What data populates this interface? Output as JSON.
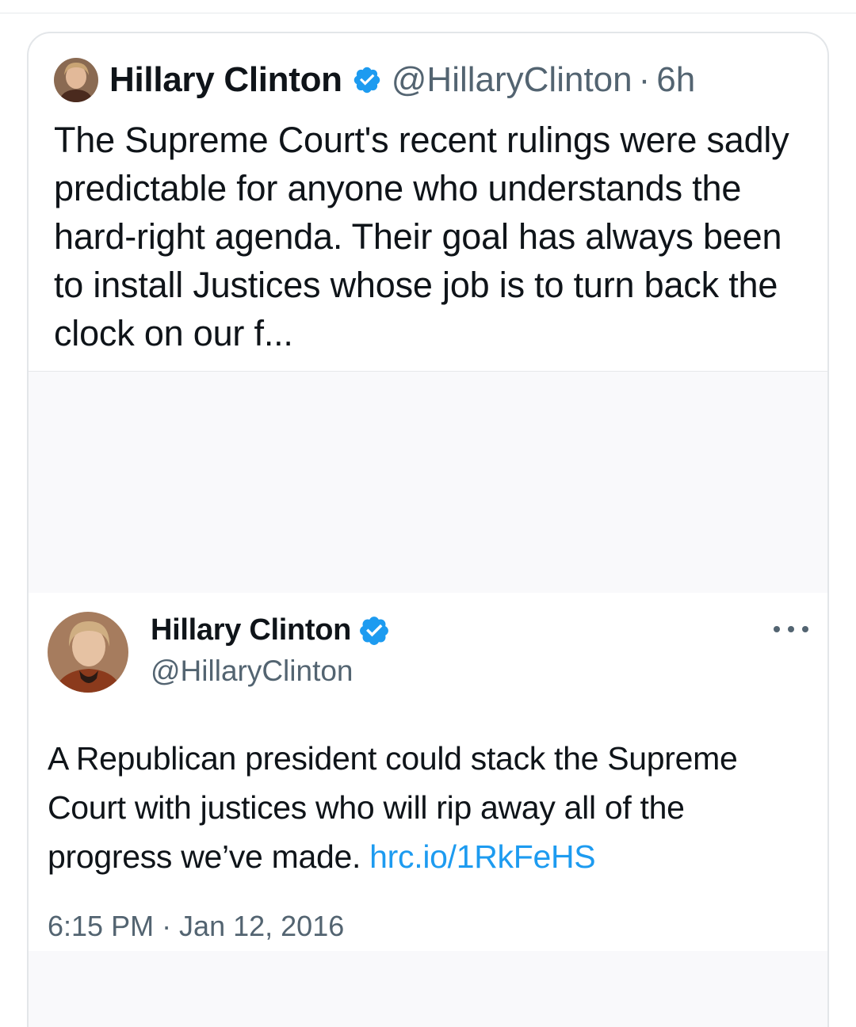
{
  "quote": {
    "author_name": "Hillary Clinton",
    "handle": "@HillaryClinton",
    "separator": "·",
    "age": "6h",
    "text": "The Supreme Court's recent rulings were sadly predictable for anyone who understands the hard-right agenda. Their goal has always been to install Justices whose job is to turn back the clock on our f...",
    "verified_icon": "verified-badge-icon",
    "avatar_icon": "profile-photo-avatar"
  },
  "embedded_tweet": {
    "author_name": "Hillary Clinton",
    "handle": "@HillaryClinton",
    "text": "A Republican president could stack the Supreme Court with justices who will rip away all of the progress we’ve made.",
    "link": "hrc.io/1RkFeHS",
    "timestamp": "6:15 PM · Jan 12, 2016",
    "more_icon": "more-options-icon"
  },
  "colors": {
    "text_primary": "#0f1419",
    "text_secondary": "#536471",
    "link": "#1d9bf0",
    "verified": "#1d9bf0",
    "card_border": "#e3e6e9",
    "media_background": "#f9f9fb"
  }
}
